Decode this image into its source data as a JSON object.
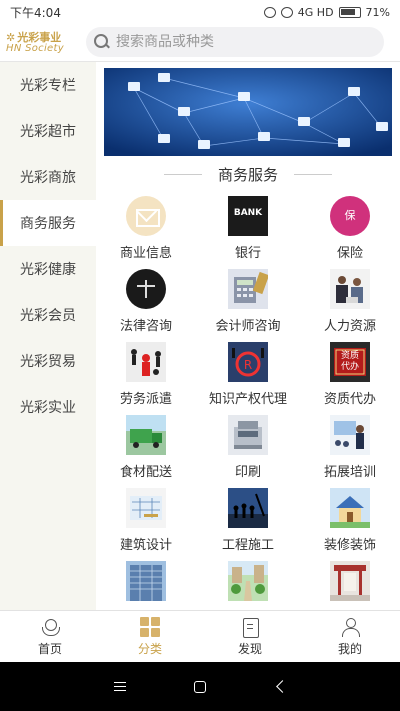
{
  "status_bar": {
    "time": "下午4:04",
    "network": "4G HD",
    "battery": "71%"
  },
  "header": {
    "logo_cn": "光彩事业",
    "logo_en": "HN Society",
    "search_placeholder": "搜索商品或种类"
  },
  "sidebar": {
    "active_index": 3,
    "items": [
      {
        "label": "光彩专栏"
      },
      {
        "label": "光彩超市"
      },
      {
        "label": "光彩商旅"
      },
      {
        "label": "商务服务"
      },
      {
        "label": "光彩健康"
      },
      {
        "label": "光彩会员"
      },
      {
        "label": "光彩贸易"
      },
      {
        "label": "光彩实业"
      }
    ]
  },
  "section": {
    "title": "商务服务"
  },
  "services": [
    {
      "label": "商业信息",
      "icon": "envelope-icon"
    },
    {
      "label": "银行",
      "icon": "bank-icon"
    },
    {
      "label": "保险",
      "icon": "insurance-icon",
      "icon_text": "保"
    },
    {
      "label": "法律咨询",
      "icon": "scales-icon"
    },
    {
      "label": "会计师咨询",
      "icon": "calculator-icon"
    },
    {
      "label": "人力资源",
      "icon": "people-icon"
    },
    {
      "label": "劳务派遣",
      "icon": "workers-icon"
    },
    {
      "label": "知识产权代理",
      "icon": "trademark-icon"
    },
    {
      "label": "资质代办",
      "icon": "license-icon",
      "icon_text": "资质代办"
    },
    {
      "label": "食材配送",
      "icon": "truck-icon"
    },
    {
      "label": "印刷",
      "icon": "printer-icon"
    },
    {
      "label": "拓展培训",
      "icon": "training-icon"
    },
    {
      "label": "建筑设计",
      "icon": "blueprint-icon"
    },
    {
      "label": "工程施工",
      "icon": "construction-icon"
    },
    {
      "label": "装修装饰",
      "icon": "house-icon"
    },
    {
      "label": "",
      "icon": "building-icon"
    },
    {
      "label": "",
      "icon": "garden-icon"
    },
    {
      "label": "",
      "icon": "interior-icon"
    }
  ],
  "bank_text": "BANK",
  "bottom_nav": [
    {
      "label": "首页",
      "icon": "home-icon"
    },
    {
      "label": "分类",
      "icon": "category-icon"
    },
    {
      "label": "发现",
      "icon": "discover-icon"
    },
    {
      "label": "我的",
      "icon": "profile-icon"
    }
  ],
  "bottom_nav_active": 1,
  "colors": {
    "accent": "#c9a24a",
    "sidebar_bg": "#f6f6f0",
    "banner": "#0d3d86"
  }
}
